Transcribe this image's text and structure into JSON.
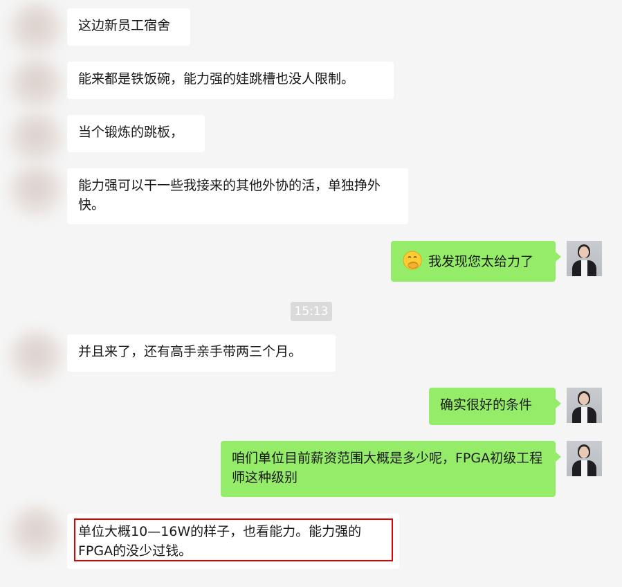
{
  "messages": {
    "m1": "这边新员工宿舍",
    "m2": "能来都是铁饭碗，能力强的娃跳槽也没人限制。",
    "m3": "当个锻炼的跳板，",
    "m4": "能力强可以干一些我接来的其他外协的活，单独挣外快。",
    "m5": "我发现您太给力了",
    "m6": "并且来了，还有高手亲手带两三个月。",
    "m7": "确实很好的条件",
    "m8": "咱们单位目前薪资范围大概是多少呢，FPGA初级工程师这种级别",
    "m9": "单位大概10—16W的样子，也看能力。能力强的FPGA的没少过钱。"
  },
  "timestamp": "15:13",
  "emoji_icon": "thinking-hand-over-mouth-emoji",
  "colors": {
    "background": "#f5f5f5",
    "incoming_bubble": "#ffffff",
    "outgoing_bubble": "#95ec69",
    "highlight_border": "#e00000"
  }
}
